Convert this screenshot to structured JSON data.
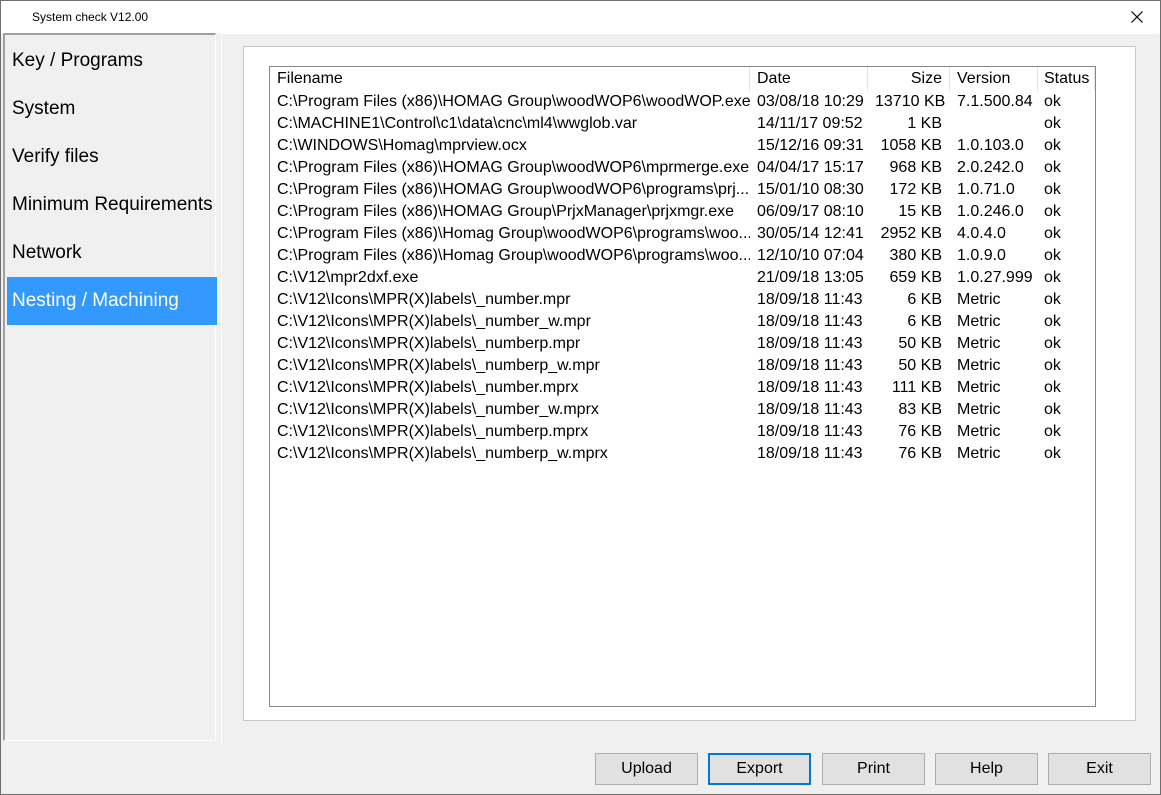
{
  "window": {
    "title": "System check V12.00"
  },
  "sidebar": {
    "items": [
      {
        "label": "Key / Programs"
      },
      {
        "label": "System"
      },
      {
        "label": "Verify files"
      },
      {
        "label": "Minimum Requirements"
      },
      {
        "label": "Network"
      },
      {
        "label": "Nesting / Machining",
        "selected": true
      }
    ],
    "selected_color": "#3399ff"
  },
  "table": {
    "columns": [
      "Filename",
      "Date",
      "Size",
      "Version",
      "Status"
    ],
    "rows": [
      [
        "C:\\Program Files (x86)\\HOMAG Group\\woodWOP6\\woodWOP.exe",
        "03/08/18 10:29",
        "13710 KB",
        "7.1.500.84",
        "ok"
      ],
      [
        "C:\\MACHINE1\\Control\\c1\\data\\cnc\\ml4\\wwglob.var",
        "14/11/17 09:52",
        "1 KB",
        "",
        "ok"
      ],
      [
        "C:\\WINDOWS\\Homag\\mprview.ocx",
        "15/12/16 09:31",
        "1058 KB",
        "1.0.103.0",
        "ok"
      ],
      [
        "C:\\Program Files (x86)\\HOMAG Group\\woodWOP6\\mprmerge.exe",
        "04/04/17 15:17",
        "968 KB",
        "2.0.242.0",
        "ok"
      ],
      [
        "C:\\Program Files (x86)\\HOMAG Group\\woodWOP6\\programs\\prj...",
        "15/01/10 08:30",
        "172 KB",
        "1.0.71.0",
        "ok"
      ],
      [
        "C:\\Program Files (x86)\\HOMAG Group\\PrjxManager\\prjxmgr.exe",
        "06/09/17 08:10",
        "15 KB",
        "1.0.246.0",
        "ok"
      ],
      [
        "C:\\Program Files (x86)\\Homag Group\\woodWOP6\\programs\\woo...",
        "30/05/14 12:41",
        "2952 KB",
        "4.0.4.0",
        "ok"
      ],
      [
        "C:\\Program Files (x86)\\Homag Group\\woodWOP6\\programs\\woo...",
        "12/10/10 07:04",
        "380 KB",
        "1.0.9.0",
        "ok"
      ],
      [
        "C:\\V12\\mpr2dxf.exe",
        "21/09/18 13:05",
        "659 KB",
        "1.0.27.999",
        "ok"
      ],
      [
        "C:\\V12\\Icons\\MPR(X)labels\\_number.mpr",
        "18/09/18 11:43",
        "6 KB",
        "Metric",
        "ok"
      ],
      [
        "C:\\V12\\Icons\\MPR(X)labels\\_number_w.mpr",
        "18/09/18 11:43",
        "6 KB",
        "Metric",
        "ok"
      ],
      [
        "C:\\V12\\Icons\\MPR(X)labels\\_numberp.mpr",
        "18/09/18 11:43",
        "50 KB",
        "Metric",
        "ok"
      ],
      [
        "C:\\V12\\Icons\\MPR(X)labels\\_numberp_w.mpr",
        "18/09/18 11:43",
        "50 KB",
        "Metric",
        "ok"
      ],
      [
        "C:\\V12\\Icons\\MPR(X)labels\\_number.mprx",
        "18/09/18 11:43",
        "111 KB",
        "Metric",
        "ok"
      ],
      [
        "C:\\V12\\Icons\\MPR(X)labels\\_number_w.mprx",
        "18/09/18 11:43",
        "83 KB",
        "Metric",
        "ok"
      ],
      [
        "C:\\V12\\Icons\\MPR(X)labels\\_numberp.mprx",
        "18/09/18 11:43",
        "76 KB",
        "Metric",
        "ok"
      ],
      [
        "C:\\V12\\Icons\\MPR(X)labels\\_numberp_w.mprx",
        "18/09/18 11:43",
        "76 KB",
        "Metric",
        "ok"
      ]
    ]
  },
  "buttons": {
    "upload": "Upload",
    "export": "Export",
    "print": "Print",
    "help": "Help",
    "exit": "Exit"
  },
  "icons": {
    "close": "close-icon"
  }
}
